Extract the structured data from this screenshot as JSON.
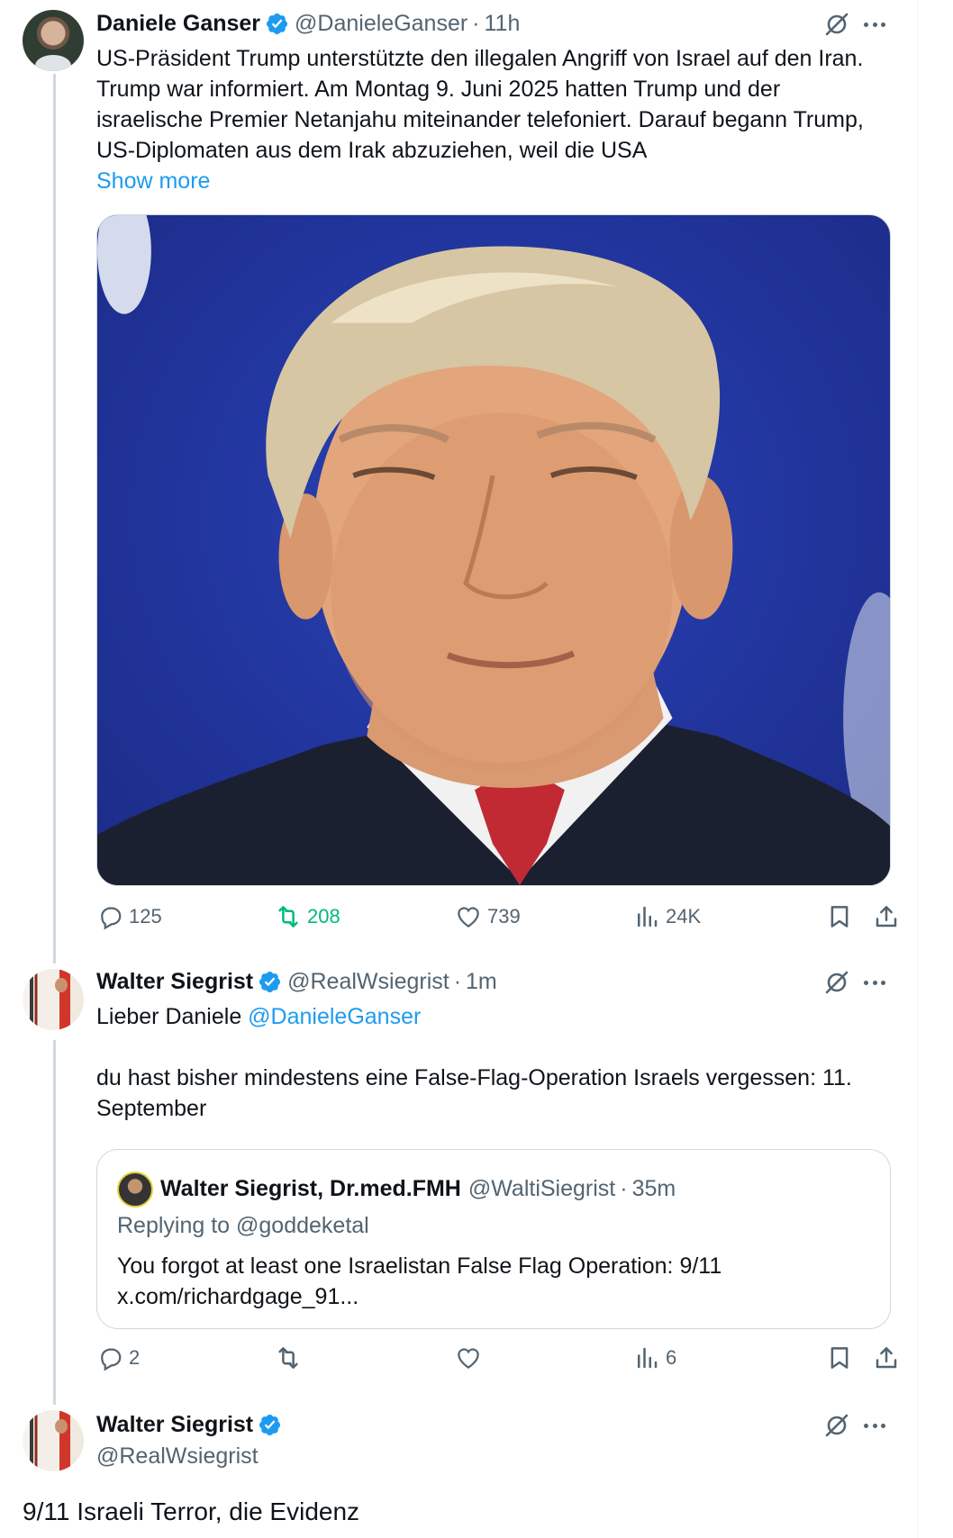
{
  "post1": {
    "name": "Daniele Ganser",
    "handle": "@DanieleGanser",
    "separator": "·",
    "time": "11h",
    "text": "US-Präsident Trump unterstützte den illegalen Angriff von Israel auf den Iran. Trump war informiert. Am Montag 9. Juni 2025 hatten Trump und der israelische Premier Netanjahu miteinander telefoniert. Darauf begann Trump, US-Diplomaten aus dem Irak abzuziehen, weil die USA",
    "show_more": "Show more",
    "stats": {
      "replies": "125",
      "reposts": "208",
      "likes": "739",
      "views": "24K"
    }
  },
  "post2": {
    "name": "Walter Siegrist",
    "handle": "@RealWsiegrist",
    "separator": "·",
    "time": "1m",
    "greeting": "Lieber Daniele",
    "mention": "@DanieleGanser",
    "text": "du hast bisher mindestens eine False-Flag-Operation Israels vergessen: 11. September",
    "quote": {
      "name": "Walter Siegrist, Dr.med.FMH",
      "handle": "@WaltiSiegrist",
      "separator": "·",
      "time": "35m",
      "replying": "Replying to @goddeketal",
      "text": "You forgot at least one Israelistan False Flag Operation: 9/11",
      "link": "x.com/richardgage_91..."
    },
    "stats": {
      "replies": "2",
      "reposts": "",
      "likes": "",
      "views": "6"
    }
  },
  "post3": {
    "name": "Walter Siegrist",
    "handle": "@RealWsiegrist",
    "text": "9/11 Israeli Terror, die Evidenz"
  },
  "colors": {
    "accent": "#1d9bf0",
    "repost_green": "#00ba7c",
    "muted": "#536471"
  },
  "icons": [
    "verified-badge-icon",
    "grok-icon",
    "more-icon",
    "reply-icon",
    "repost-icon",
    "like-icon",
    "views-icon",
    "bookmark-icon",
    "share-icon"
  ]
}
